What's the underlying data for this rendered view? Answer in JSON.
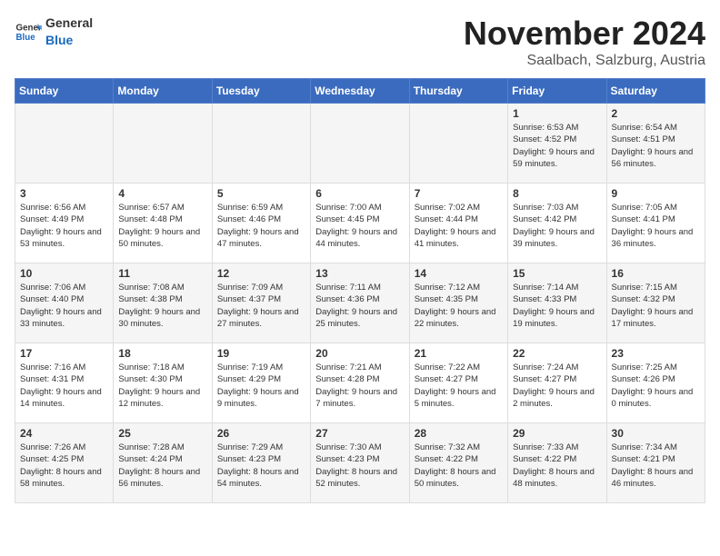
{
  "logo": {
    "general": "General",
    "blue": "Blue"
  },
  "title": "November 2024",
  "subtitle": "Saalbach, Salzburg, Austria",
  "days_of_week": [
    "Sunday",
    "Monday",
    "Tuesday",
    "Wednesday",
    "Thursday",
    "Friday",
    "Saturday"
  ],
  "weeks": [
    [
      {
        "day": "",
        "info": ""
      },
      {
        "day": "",
        "info": ""
      },
      {
        "day": "",
        "info": ""
      },
      {
        "day": "",
        "info": ""
      },
      {
        "day": "",
        "info": ""
      },
      {
        "day": "1",
        "info": "Sunrise: 6:53 AM\nSunset: 4:52 PM\nDaylight: 9 hours and 59 minutes."
      },
      {
        "day": "2",
        "info": "Sunrise: 6:54 AM\nSunset: 4:51 PM\nDaylight: 9 hours and 56 minutes."
      }
    ],
    [
      {
        "day": "3",
        "info": "Sunrise: 6:56 AM\nSunset: 4:49 PM\nDaylight: 9 hours and 53 minutes."
      },
      {
        "day": "4",
        "info": "Sunrise: 6:57 AM\nSunset: 4:48 PM\nDaylight: 9 hours and 50 minutes."
      },
      {
        "day": "5",
        "info": "Sunrise: 6:59 AM\nSunset: 4:46 PM\nDaylight: 9 hours and 47 minutes."
      },
      {
        "day": "6",
        "info": "Sunrise: 7:00 AM\nSunset: 4:45 PM\nDaylight: 9 hours and 44 minutes."
      },
      {
        "day": "7",
        "info": "Sunrise: 7:02 AM\nSunset: 4:44 PM\nDaylight: 9 hours and 41 minutes."
      },
      {
        "day": "8",
        "info": "Sunrise: 7:03 AM\nSunset: 4:42 PM\nDaylight: 9 hours and 39 minutes."
      },
      {
        "day": "9",
        "info": "Sunrise: 7:05 AM\nSunset: 4:41 PM\nDaylight: 9 hours and 36 minutes."
      }
    ],
    [
      {
        "day": "10",
        "info": "Sunrise: 7:06 AM\nSunset: 4:40 PM\nDaylight: 9 hours and 33 minutes."
      },
      {
        "day": "11",
        "info": "Sunrise: 7:08 AM\nSunset: 4:38 PM\nDaylight: 9 hours and 30 minutes."
      },
      {
        "day": "12",
        "info": "Sunrise: 7:09 AM\nSunset: 4:37 PM\nDaylight: 9 hours and 27 minutes."
      },
      {
        "day": "13",
        "info": "Sunrise: 7:11 AM\nSunset: 4:36 PM\nDaylight: 9 hours and 25 minutes."
      },
      {
        "day": "14",
        "info": "Sunrise: 7:12 AM\nSunset: 4:35 PM\nDaylight: 9 hours and 22 minutes."
      },
      {
        "day": "15",
        "info": "Sunrise: 7:14 AM\nSunset: 4:33 PM\nDaylight: 9 hours and 19 minutes."
      },
      {
        "day": "16",
        "info": "Sunrise: 7:15 AM\nSunset: 4:32 PM\nDaylight: 9 hours and 17 minutes."
      }
    ],
    [
      {
        "day": "17",
        "info": "Sunrise: 7:16 AM\nSunset: 4:31 PM\nDaylight: 9 hours and 14 minutes."
      },
      {
        "day": "18",
        "info": "Sunrise: 7:18 AM\nSunset: 4:30 PM\nDaylight: 9 hours and 12 minutes."
      },
      {
        "day": "19",
        "info": "Sunrise: 7:19 AM\nSunset: 4:29 PM\nDaylight: 9 hours and 9 minutes."
      },
      {
        "day": "20",
        "info": "Sunrise: 7:21 AM\nSunset: 4:28 PM\nDaylight: 9 hours and 7 minutes."
      },
      {
        "day": "21",
        "info": "Sunrise: 7:22 AM\nSunset: 4:27 PM\nDaylight: 9 hours and 5 minutes."
      },
      {
        "day": "22",
        "info": "Sunrise: 7:24 AM\nSunset: 4:27 PM\nDaylight: 9 hours and 2 minutes."
      },
      {
        "day": "23",
        "info": "Sunrise: 7:25 AM\nSunset: 4:26 PM\nDaylight: 9 hours and 0 minutes."
      }
    ],
    [
      {
        "day": "24",
        "info": "Sunrise: 7:26 AM\nSunset: 4:25 PM\nDaylight: 8 hours and 58 minutes."
      },
      {
        "day": "25",
        "info": "Sunrise: 7:28 AM\nSunset: 4:24 PM\nDaylight: 8 hours and 56 minutes."
      },
      {
        "day": "26",
        "info": "Sunrise: 7:29 AM\nSunset: 4:23 PM\nDaylight: 8 hours and 54 minutes."
      },
      {
        "day": "27",
        "info": "Sunrise: 7:30 AM\nSunset: 4:23 PM\nDaylight: 8 hours and 52 minutes."
      },
      {
        "day": "28",
        "info": "Sunrise: 7:32 AM\nSunset: 4:22 PM\nDaylight: 8 hours and 50 minutes."
      },
      {
        "day": "29",
        "info": "Sunrise: 7:33 AM\nSunset: 4:22 PM\nDaylight: 8 hours and 48 minutes."
      },
      {
        "day": "30",
        "info": "Sunrise: 7:34 AM\nSunset: 4:21 PM\nDaylight: 8 hours and 46 minutes."
      }
    ]
  ]
}
